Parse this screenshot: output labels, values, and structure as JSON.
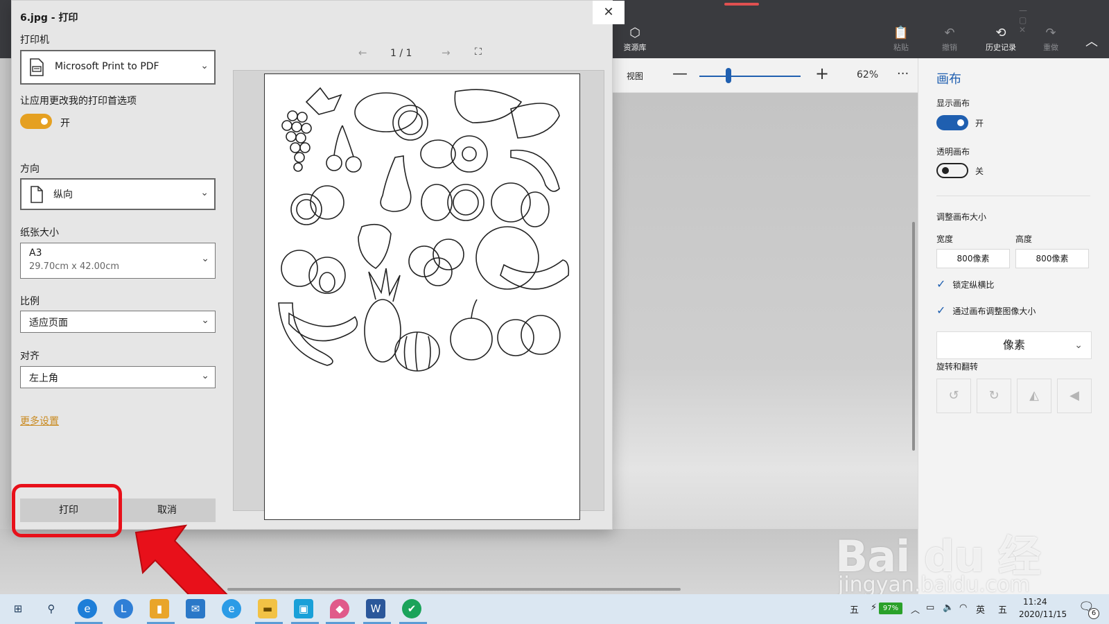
{
  "dialog": {
    "title": "6.jpg - 打印",
    "printer_label": "打印机",
    "printer_value": "Microsoft Print to PDF",
    "allow_app_prefs_label": "让应用更改我的打印首选项",
    "allow_app_prefs_state": "开",
    "orientation_label": "方向",
    "orientation_value": "纵向",
    "paper_size_label": "纸张大小",
    "paper_size_value": "A3",
    "paper_size_dims": "29.70cm x 42.00cm",
    "scale_label": "比例",
    "scale_value": "适应页面",
    "alignment_label": "对齐",
    "alignment_value": "左上角",
    "more_settings": "更多设置",
    "print_button": "打印",
    "cancel_button": "取消",
    "page_indicator": "1 / 1",
    "colors": {
      "toggle": "#e5a021",
      "link": "#c98a20",
      "highlight": "#e8101a"
    }
  },
  "app": {
    "toolbar": {
      "library": "资源库",
      "paste": "粘贴",
      "undo": "撤销",
      "history": "历史记录",
      "redo": "重做"
    },
    "view_label": "视图",
    "zoom": {
      "value_text": "62%",
      "slider_fraction": 0.29,
      "more": "···"
    },
    "panel": {
      "title": "画布",
      "show_canvas_label": "显示画布",
      "show_canvas_state": "开",
      "transparent_canvas_label": "透明画布",
      "transparent_canvas_state": "关",
      "resize_label": "调整画布大小",
      "width_label": "宽度",
      "height_label": "高度",
      "width_value": "800像素",
      "height_value": "800像素",
      "lock_ratio": "锁定纵横比",
      "resize_image": "通过画布调整图像大小",
      "unit_value": "像素",
      "rotate_label": "旋转和翻转",
      "accent_color": "#1f5fb0"
    }
  },
  "watermark": {
    "main": "Bai du 经验",
    "sub": "jingyan.baidu.com"
  },
  "taskbar": {
    "ime_left": "五",
    "battery_text": "97%",
    "lang": "英",
    "ime_right": "五",
    "time": "11:24",
    "date": "2020/11/15",
    "notifications": "6"
  }
}
